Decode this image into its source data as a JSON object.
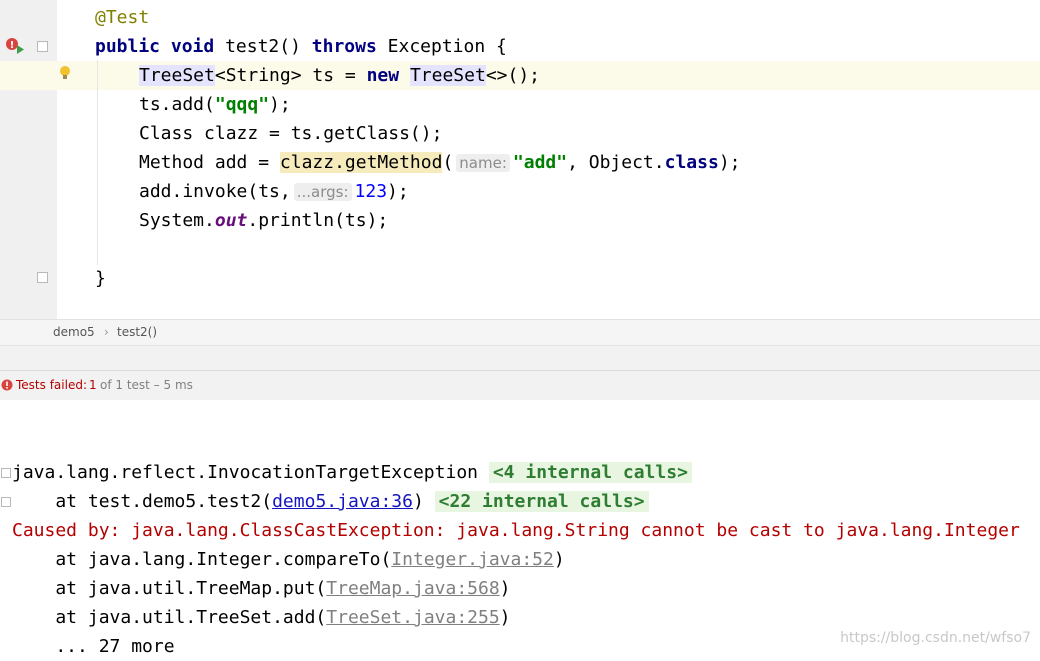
{
  "editor": {
    "lines": {
      "annotation": "@Test",
      "method_public": "public",
      "method_void": "void",
      "method_name": " test2() ",
      "method_throws": "throws",
      "method_rest": " Exception {",
      "l3_type": "TreeSet",
      "l3_generic": "<String>",
      "l3_mid": " ts = ",
      "l3_new": "new",
      "l3_type2": "TreeSet",
      "l3_end": "<>();",
      "l4_a": "ts.add(",
      "l4_str": "\"qqq\"",
      "l4_b": ");",
      "l5": "Class clazz = ts.getClass();",
      "l6_a": "Method add = ",
      "l6_call": "clazz.getMethod",
      "l6_paren": "(",
      "l6_hint": "name:",
      "l6_str": "\"add\"",
      "l6_b": ", Object.",
      "l6_class": "class",
      "l6_c": ");",
      "l7_a": "add.invoke(ts,",
      "l7_hint": "...args:",
      "l7_num": "123",
      "l7_b": ");",
      "l8_a": "System.",
      "l8_out": "out",
      "l8_b": ".println(ts);",
      "close_brace": "}"
    }
  },
  "breadcrumb": {
    "class_name": "demo5",
    "separator": "›",
    "method_name": "test2()"
  },
  "test_status": {
    "label": "Tests failed:",
    "failed": "1",
    "detail": "of 1 test – 5 ms"
  },
  "console": {
    "l1_text": "java.lang.reflect.InvocationTargetException",
    "l1_fold": "<4 internal calls>",
    "l2_prefix": "    at test.demo5.test2(",
    "l2_link": "demo5.java:36",
    "l2_suffix": ")",
    "l2_fold": "<22 internal calls>",
    "l3_text": "Caused by: java.lang.ClassCastException: java.lang.String cannot be cast to java.lang.Integer",
    "l4_prefix": "    at java.lang.Integer.compareTo(",
    "l4_link": "Integer.java:52",
    "l4_suffix": ")",
    "l5_prefix": "    at java.util.TreeMap.put(",
    "l5_link": "TreeMap.java:568",
    "l5_suffix": ")",
    "l6_prefix": "    at java.util.TreeSet.add(",
    "l6_link": "TreeSet.java:255",
    "l6_suffix": ")",
    "l7_text": "    ... 27 more"
  },
  "watermark": "https://blog.csdn.net/wfso7",
  "colors": {
    "keyword": "#000080",
    "string": "#008000",
    "number": "#0000ff",
    "error": "#b40000",
    "folded_bg": "#e8f5e1",
    "caret_row": "#fcfae8"
  }
}
